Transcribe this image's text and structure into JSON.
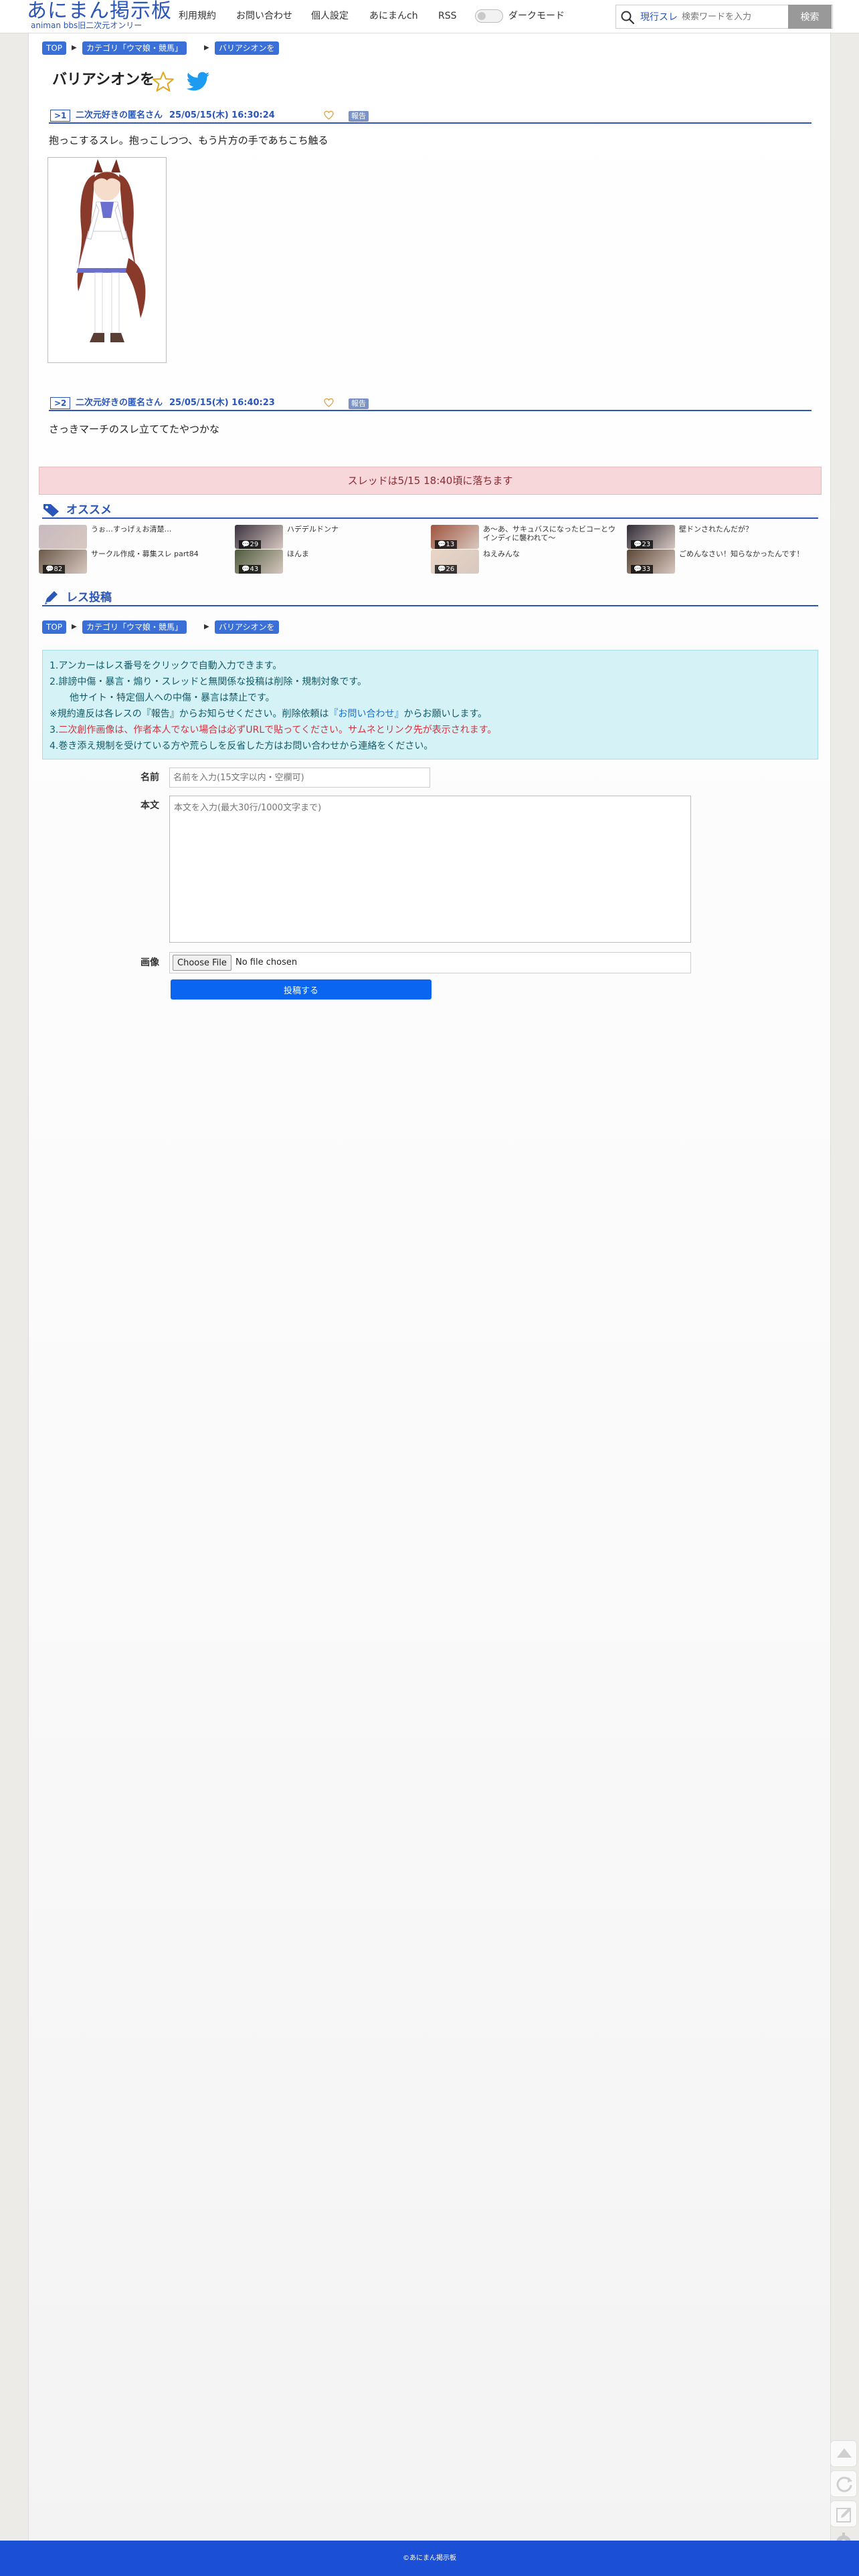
{
  "header": {
    "logo_main": "あにまん掲示板",
    "logo_sub": "animan bbs旧二次元オンリー",
    "nav": [
      "利用規約",
      "お問い合わせ",
      "個人設定",
      "あにまんch",
      "RSS"
    ],
    "dark_mode_label": "ダークモード",
    "search_scope": "現行スレ",
    "search_placeholder": "検索ワードを入力",
    "search_button": "検索"
  },
  "breadcrumb": [
    "TOP",
    "カテゴリ「ウマ娘・競馬」",
    "バリアシオンを"
  ],
  "thread": {
    "title": "バリアシオンを",
    "posts": [
      {
        "num": ">1",
        "name": "二次元好きの匿名さん",
        "date": "25/05/15(木) 16:30:24",
        "report": "報告",
        "body": "抱っこするスレ。抱っこしつつ、もう片方の手であちこち触る"
      },
      {
        "num": ">2",
        "name": "二次元好きの匿名さん",
        "date": "25/05/15(木) 16:40:23",
        "report": "報告",
        "body": "さっきマーチのスレ立ててたやつかな"
      }
    ],
    "fall_notice": "スレッドは5/15 18:40頃に落ちます"
  },
  "osusume": {
    "heading": "オススメ",
    "items": [
      {
        "title": "うぉ…すっげぇお清楚…",
        "count": "",
        "color": "#c7b9c0"
      },
      {
        "title": "サークル作成・募集スレ part84",
        "count": "82",
        "color": "#6b5a4a"
      },
      {
        "title": "ハデデルドンナ",
        "count": "29",
        "color": "#3b3240"
      },
      {
        "title": "ほんま",
        "count": "43",
        "color": "#4c5a3c"
      },
      {
        "title": "あ〜あ、サキュバスになったビコーとウインディに襲われて〜",
        "count": "13",
        "color": "#a0553e"
      },
      {
        "title": "ねえみんな",
        "count": "26",
        "color": "#e9d6c6"
      },
      {
        "title": "壁ドンされたんだが？",
        "count": "23",
        "color": "#2e2a36"
      },
      {
        "title": "ごめんなさい！知らなかったんです！",
        "count": "33",
        "color": "#5b4636"
      }
    ]
  },
  "reply": {
    "heading": "レス投稿",
    "rules": [
      "1.アンカーはレス番号をクリックで自動入力できます。",
      "2.誹謗中傷・暴言・煽り・スレッドと無関係な投稿は削除・規制対象です。",
      "他サイト・特定個人への中傷・暴言は禁止です。",
      "※規約違反は各レスの『報告』からお知らせください。削除依頼は",
      "『お問い合わせ』",
      "からお願いします。",
      "3.",
      "二次創作画像は、作者本人でない場合は必ずURLで貼ってください。サムネとリンク先が表示されます。",
      "4.巻き添え規制を受けている方や荒らしを反省した方はお問い合わせから連絡をください。"
    ],
    "name_label": "名前",
    "name_placeholder": "名前を入力(15文字以内・空欄可)",
    "body_label": "本文",
    "body_placeholder": "本文を入力(最大30行/1000文字まで)",
    "image_label": "画像",
    "choose_file": "Choose File",
    "file_status": "No file chosen",
    "submit": "投稿する"
  },
  "footer": {
    "copyright": "©あにまん掲示板"
  },
  "colors": {
    "brand": "#2a56b8",
    "footer": "#1b4fd6",
    "notice_bg": "#f7d7da",
    "rules_bg": "#d5f3f6",
    "submit": "#0a66f0"
  },
  "icons": [
    "search-icon",
    "star-icon",
    "twitter-icon",
    "heart-icon",
    "tag-icon",
    "pencil-icon",
    "scroll-top-icon",
    "reload-icon",
    "edit-icon",
    "gear-icon"
  ]
}
